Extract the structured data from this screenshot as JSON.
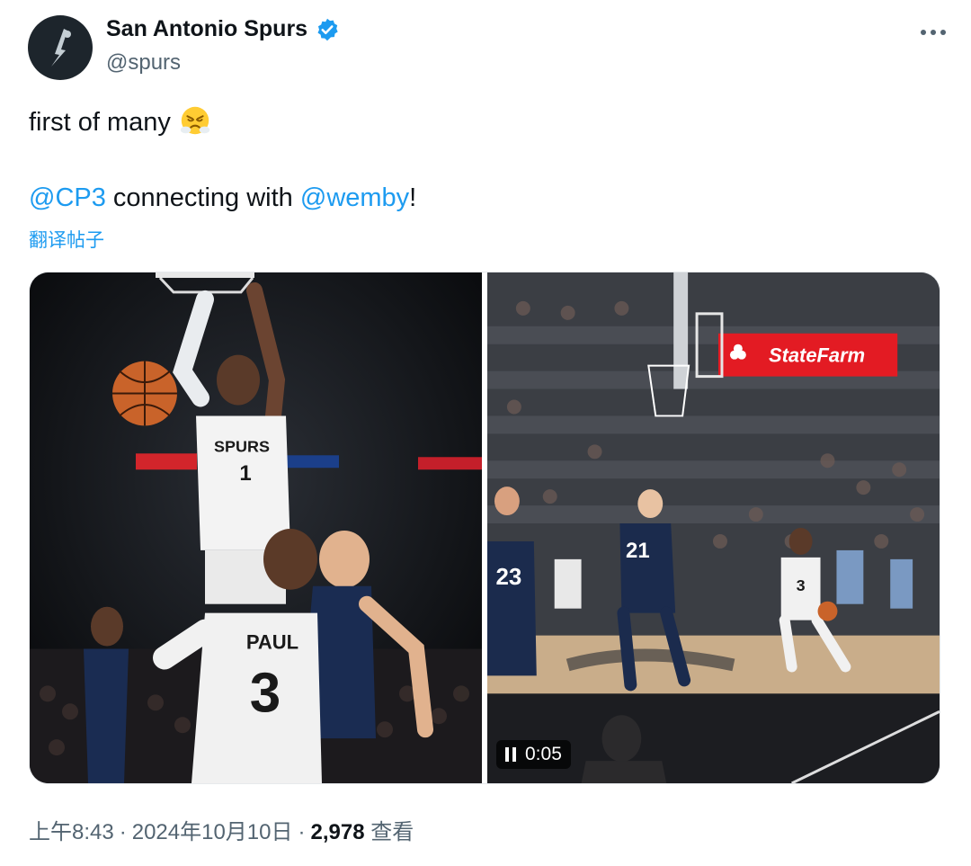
{
  "account": {
    "display_name": "San Antonio Spurs",
    "handle": "@spurs",
    "verified": true
  },
  "tweet": {
    "line1": "first of many",
    "line1_emoji": "face-with-steam-emoji",
    "mention1": "@CP3",
    "middle_text": " connecting with ",
    "mention2": "@wemby",
    "end_text": "!",
    "translate_label": "翻译帖子"
  },
  "media": {
    "left_image": {
      "jersey_name": "PAUL",
      "jersey_number_front": "3",
      "dunker_jersey_text": "SPURS",
      "dunker_number": "1"
    },
    "right_video": {
      "sponsor_text": "StateFarm",
      "player_numbers": [
        "23",
        "21",
        "3"
      ],
      "timestamp": "0:05",
      "state": "playing"
    }
  },
  "meta": {
    "time": "上午8:43",
    "date": "2024年10月10日",
    "views_count": "2,978",
    "views_label": "查看"
  },
  "colors": {
    "link": "#1d9bf0",
    "muted": "#536471",
    "text": "#0f1419",
    "verified": "#1d9bf0",
    "statefarm_red": "#e31b23"
  }
}
